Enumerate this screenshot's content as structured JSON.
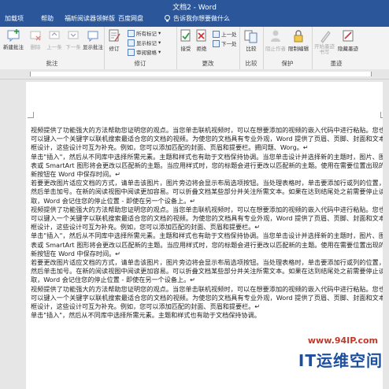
{
  "window": {
    "title": "文档2 - Word"
  },
  "tabs": [
    {
      "label": "加载项"
    },
    {
      "label": "帮助"
    },
    {
      "label": "福昕阅读器领鲜版"
    },
    {
      "label": "百度网盘"
    },
    {
      "label": "告诉我你想要做什么"
    }
  ],
  "ribbon": {
    "new_comment": "新建批注",
    "delete": "删除",
    "previous": "上一条",
    "next": "下一条",
    "show_comments": "显示批注",
    "track_changes": "修订",
    "all_markup": "所有标记",
    "show_markup": "显示标记",
    "reviewing_pane": "审阅窗格",
    "accept": "接受",
    "reject": "拒绝",
    "prev_change": "上一处",
    "next_change": "下一处",
    "compare": "比较",
    "block_authors": "阻止作者",
    "restrict_editing": "限制编辑",
    "start_inking": "开始墨迹书写",
    "hide_ink": "隐藏墨迹",
    "groups": {
      "comments": "批注",
      "tracking": "修订",
      "changes": "更改",
      "compare": "比较",
      "protect": "保护",
      "ink": "墨迹"
    }
  },
  "document": {
    "paragraphs": [
      "视频提供了功能强大的方法帮助您证明您的观点。当您单击联机视频时，可以在想要添加的视频的嵌入代码中进行粘贴。您也可以键入一个关键字以联机搜索最适合您的文档的视频。为使您的文档具有专业外观，Word 提供了页眉、页脚、封面和文本框设计，这些设计可互为补充。例如，您可以添加匹配的封面、页眉和提要栏。拥问题、Worg。↵",
      "单击\"插入\"，然后从不同库中选择所需元素。主题和样式也有助于文档保持协调。当您单击设计并选择新的主题时，图片、图表或 SmartArt 图形将会更改以匹配新的主题。当应用样式时，您的标题会进行更改以匹配新的主题。使用在需要位置出现的新按钮在 Word 中保存时间。↵",
      "若要更改图片适应文档的方式，请单击该图片，图片旁边将会显示布局选项按钮。当处理表格时，单击要添加行或列的位置，然后单击加号。在新的阅读视图中阅读更加容易。可以折叠文档某些部分并关注所需文本。如果在达到结尾处之前需要停止读取，Word 会记住您的停止位置 - 即使在另一个设备上。↵",
      "视频提供了功能强大的方法帮助您证明您的观点。当您单击联机视频时，可以在想要添加的视频的嵌入代码中进行粘贴。您也可以键入一个关键字以联机搜索最适合您的文档的视频。为使您的文档具有专业外观，Word 提供了页眉、页脚、封面和文本框设计，这些设计可互为补充。例如，您可以添加匹配的封面、页眉和提要栏。↵",
      "单击\"插入\"，然后从不同库中选择所需元素。主题和样式也有助于文档保持协调。当您单击设计并选择新的主题时，图片、图表或 SmartArt 图形将会更改以匹配新的主题。当应用样式时，您的标题会进行更改以匹配新的主题。使用在需要位置出现的新按钮在 Word 中保存时间。↵",
      "若要更改图片适应文档的方式，请单击该图片，图片旁边将会显示布局选项按钮。当处理表格时，单击要添加行或列的位置，然后单击加号。在新的阅读视图中阅读更加容易。可以折叠文档某些部分并关注所需文本。如果在达到结尾处之前需要停止读取，Word 会记住您的停止位置 - 即使在另一个设备上。↵",
      "视频提供了功能强大的方法帮助您证明您的观点。当您单击联机视频时，可以在想要添加的视频的嵌入代码中进行粘贴。您也可以键入一个关键字以联机搜索最适合您的文档的视频。为使您的文档具有专业外观，Word 提供了页眉、页脚、封面和文本框设计，这些设计可互为补充。例如，您可以添加匹配的封面、页眉和提要栏。↵",
      "单击\"插入\"，然后从不同库中选择所需元素。主题和样式也有助于文档保持协调。"
    ]
  },
  "watermark": {
    "url": "www.94IP.com",
    "brand": "IT运维空间"
  },
  "colors": {
    "titlebar": "#2b579a",
    "ribbon": "#f3f3f3",
    "watermark_url": "#c0392b",
    "watermark_brand": "#1d4f9e"
  }
}
